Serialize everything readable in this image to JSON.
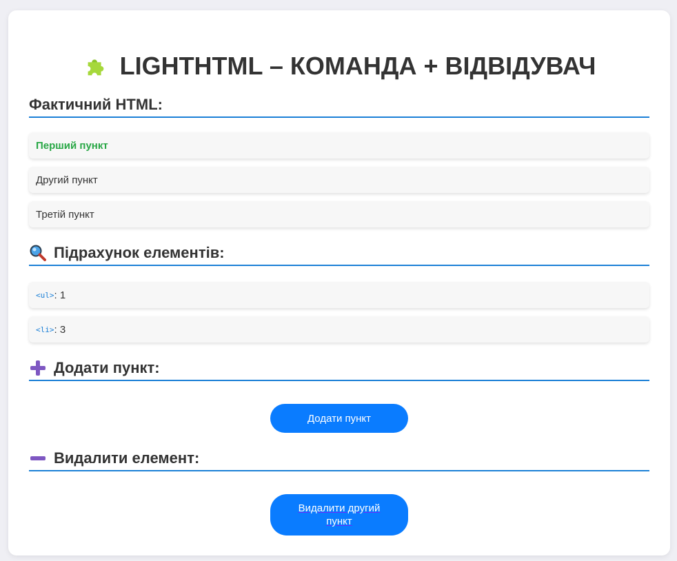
{
  "header": {
    "title": "LIGHTHTML – КОМАНДА + ВІДВІДУВАЧ",
    "icon": "puzzle-icon"
  },
  "html_section": {
    "title": "Фактичний HTML:",
    "items": [
      "Перший пункт",
      "Другий пункт",
      "Третій пункт"
    ]
  },
  "count_section": {
    "title": "Підрахунок елементів:",
    "icon": "magnifier-icon",
    "rows": [
      {
        "tag": "<ul>",
        "value": ": 1"
      },
      {
        "tag": "<li>",
        "value": ": 3"
      }
    ]
  },
  "add_section": {
    "title": "Додати пункт:",
    "icon": "plus-icon",
    "button_label": "Додати пункт"
  },
  "remove_section": {
    "title": "Видалити елемент:",
    "icon": "minus-icon",
    "button_line1": "Видалити другий",
    "button_line2": "пункт"
  },
  "colors": {
    "accent": "#0a7cff",
    "rule": "#1a7fd6",
    "highlight": "#28a745",
    "icon_purple": "#7e57c2"
  }
}
